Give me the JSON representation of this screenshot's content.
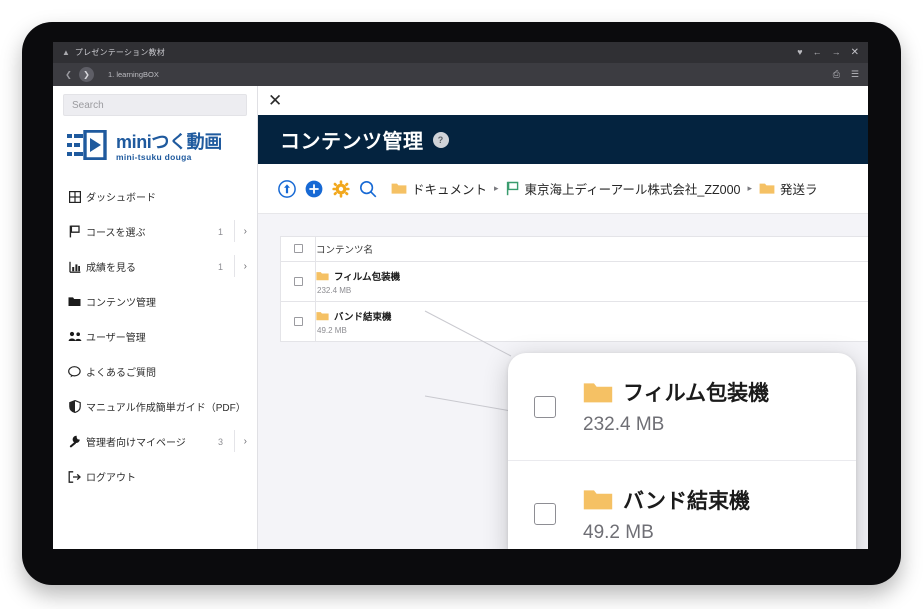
{
  "browser": {
    "window_title": "プレゼンテーション教材",
    "tab_label": "1. learningBOX",
    "collapse_icon": "chevron-up-icon",
    "favorite_icon": "heart-icon",
    "back_icon": "arrow-left-icon",
    "forward_icon": "arrow-right-icon",
    "close_icon": "close-icon",
    "share_icon": "share-icon",
    "reading_list_icon": "list-icon"
  },
  "sidebar": {
    "search": {
      "placeholder": "Search",
      "value": ""
    },
    "logo": {
      "main": "miniつく動画",
      "sub": "mini-tsuku douga"
    },
    "items": [
      {
        "label": "ダッシュボード",
        "icon": "grid-icon",
        "count": "",
        "arrow": ""
      },
      {
        "label": "コースを選ぶ",
        "icon": "flag-icon",
        "count": "1",
        "arrow": "›"
      },
      {
        "label": "成績を見る",
        "icon": "bar-chart-icon",
        "count": "1",
        "arrow": "›"
      },
      {
        "label": "コンテンツ管理",
        "icon": "folder-icon",
        "count": "",
        "arrow": ""
      },
      {
        "label": "ユーザー管理",
        "icon": "users-icon",
        "count": "",
        "arrow": ""
      },
      {
        "label": "よくあるご質問",
        "icon": "chat-icon",
        "count": "",
        "arrow": ""
      },
      {
        "label": "マニュアル作成簡単ガイド（PDF）",
        "icon": "shield-icon",
        "count": "",
        "arrow": ""
      },
      {
        "label": "管理者向けマイページ",
        "icon": "wrench-icon",
        "count": "3",
        "arrow": "›"
      },
      {
        "label": "ログアウト",
        "icon": "logout-icon",
        "count": "",
        "arrow": ""
      }
    ]
  },
  "main": {
    "close_label": "✕",
    "page_title": "コンテンツ管理",
    "help_badge": "?",
    "toolbar": {
      "upload_icon": "upload-circle-icon",
      "add_icon": "plus-circle-icon",
      "settings_icon": "gear-icon",
      "search_icon": "search-icon",
      "breadcrumbs": [
        {
          "icon": "folder-icon",
          "label": "ドキュメント"
        },
        {
          "icon": "flag-icon",
          "label": "東京海上ディーアール株式会社_ZZ000"
        },
        {
          "icon": "folder-icon",
          "label": "発送ラ"
        }
      ],
      "separator": "▸"
    },
    "table": {
      "headers": {
        "checkbox": "",
        "name": "コンテンツ名"
      },
      "rows": [
        {
          "name": "フィルム包装機",
          "size": "232.4 MB",
          "icon": "folder-icon",
          "checked": false
        },
        {
          "name": "バンド結束機",
          "size": "49.2 MB",
          "icon": "folder-icon",
          "checked": false
        }
      ]
    }
  },
  "magnifier": {
    "rows": [
      {
        "name": "フィルム包装機",
        "size": "232.4 MB",
        "icon": "folder-icon",
        "checked": false
      },
      {
        "name": "バンド結束機",
        "size": "49.2 MB",
        "icon": "folder-icon",
        "checked": false
      }
    ]
  },
  "colors": {
    "header_navy": "#04233f",
    "logo_blue": "#1f5a9e",
    "folder_yellow": "#f5c164",
    "accent_blue": "#1769d4",
    "gear_orange": "#f2a81d",
    "page_bg": "#f4f4f8",
    "frame_black": "#0b0b0d"
  }
}
